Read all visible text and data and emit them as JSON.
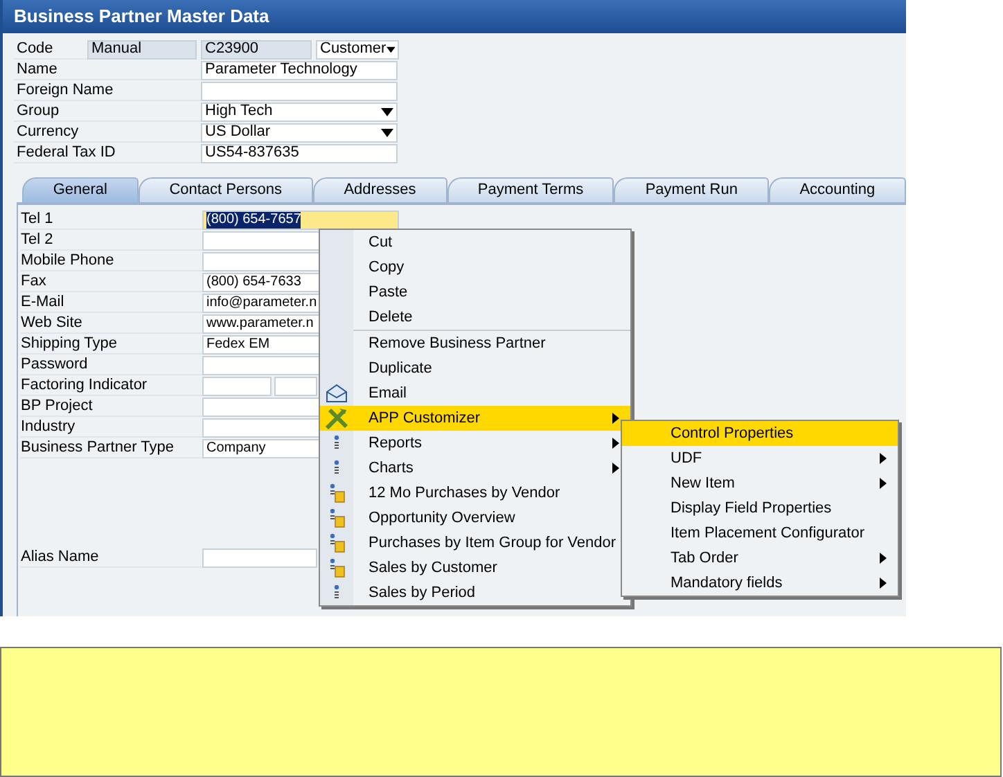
{
  "window": {
    "title": "Business Partner Master Data"
  },
  "header_fields": [
    {
      "label": "Code",
      "kind": "code",
      "series": "Manual",
      "value": "C23900",
      "type_value": "Customer"
    },
    {
      "label": "Name",
      "kind": "text",
      "value": "Parameter Technology"
    },
    {
      "label": "Foreign Name",
      "kind": "text"
    },
    {
      "label": "Group",
      "kind": "dropdown",
      "value": "High Tech"
    },
    {
      "label": "Currency",
      "kind": "dropdown",
      "value": "US Dollar"
    },
    {
      "label": "Federal Tax ID",
      "kind": "text",
      "value": "US54-837635"
    }
  ],
  "tabs": [
    {
      "label": "General",
      "selected": true
    },
    {
      "label": "Contact Persons",
      "selected": false
    },
    {
      "label": "Addresses",
      "selected": false
    },
    {
      "label": "Payment Terms",
      "selected": false
    },
    {
      "label": "Payment Run",
      "selected": false
    },
    {
      "label": "Accounting",
      "selected": false
    }
  ],
  "general_fields": [
    {
      "label": "Tel 1",
      "kind": "text",
      "value": "(800) 654-7657",
      "focused": true
    },
    {
      "label": "Tel 2",
      "kind": "text",
      "focused": false
    },
    {
      "label": "Mobile Phone",
      "kind": "text",
      "focused": false
    },
    {
      "label": "Fax",
      "kind": "text",
      "value": "(800) 654-7633",
      "focused": false
    },
    {
      "label": "E-Mail",
      "kind": "text",
      "value": "info@parameter.n",
      "focused": false
    },
    {
      "label": "Web Site",
      "kind": "text",
      "value": "www.parameter.n",
      "focused": false
    },
    {
      "label": "Shipping Type",
      "kind": "text",
      "value": "Fedex EM",
      "focused": false
    },
    {
      "label": "Password",
      "kind": "text",
      "focused": false
    },
    {
      "label": "Factoring Indicator",
      "kind": "double",
      "focused": false
    },
    {
      "label": "BP Project",
      "kind": "text",
      "focused": false
    },
    {
      "label": "Industry",
      "kind": "text",
      "focused": false
    },
    {
      "label": "Business Partner Type",
      "kind": "text",
      "value": "Company",
      "focused": false
    }
  ],
  "alias": {
    "label": "Alias Name"
  },
  "context_menu": [
    {
      "label": "Cut",
      "kind": "plain",
      "submenu": false,
      "highlighted": false
    },
    {
      "label": "Copy",
      "kind": "plain",
      "submenu": false,
      "highlighted": false
    },
    {
      "label": "Paste",
      "kind": "plain",
      "submenu": false,
      "highlighted": false
    },
    {
      "label": "Delete",
      "kind": "plain",
      "submenu": false,
      "highlighted": false
    },
    {
      "kind": "separator"
    },
    {
      "label": "Remove Business Partner",
      "kind": "plain",
      "submenu": false,
      "highlighted": false
    },
    {
      "label": "Duplicate",
      "kind": "plain",
      "submenu": false,
      "highlighted": false
    },
    {
      "label": "Email",
      "kind": "email",
      "submenu": false,
      "highlighted": false
    },
    {
      "label": "APP Customizer",
      "kind": "tools",
      "submenu": true,
      "highlighted": true
    },
    {
      "label": "Reports",
      "kind": "report",
      "submenu": true,
      "highlighted": false
    },
    {
      "label": "Charts",
      "kind": "report",
      "submenu": true,
      "highlighted": false
    },
    {
      "label": "12 Mo Purchases by Vendor",
      "kind": "query",
      "submenu": false,
      "highlighted": false
    },
    {
      "label": "Opportunity Overview",
      "kind": "query",
      "submenu": false,
      "highlighted": false
    },
    {
      "label": "Purchases by Item Group for Vendor",
      "kind": "query",
      "submenu": false,
      "highlighted": false
    },
    {
      "label": "Sales by Customer",
      "kind": "query",
      "submenu": false,
      "highlighted": false
    },
    {
      "label": "Sales by Period",
      "kind": "report",
      "submenu": false,
      "highlighted": false
    }
  ],
  "submenu": [
    {
      "label": "Control Properties",
      "submenu": false,
      "highlighted": true
    },
    {
      "label": "UDF",
      "submenu": true,
      "highlighted": false
    },
    {
      "label": "New Item",
      "submenu": true,
      "highlighted": false
    },
    {
      "label": "Display Field Properties",
      "submenu": false,
      "highlighted": false
    },
    {
      "label": "Item Placement Configurator",
      "submenu": false,
      "highlighted": false
    },
    {
      "label": "Tab Order",
      "submenu": true,
      "highlighted": false
    },
    {
      "label": "Mandatory fields",
      "submenu": true,
      "highlighted": false
    }
  ]
}
